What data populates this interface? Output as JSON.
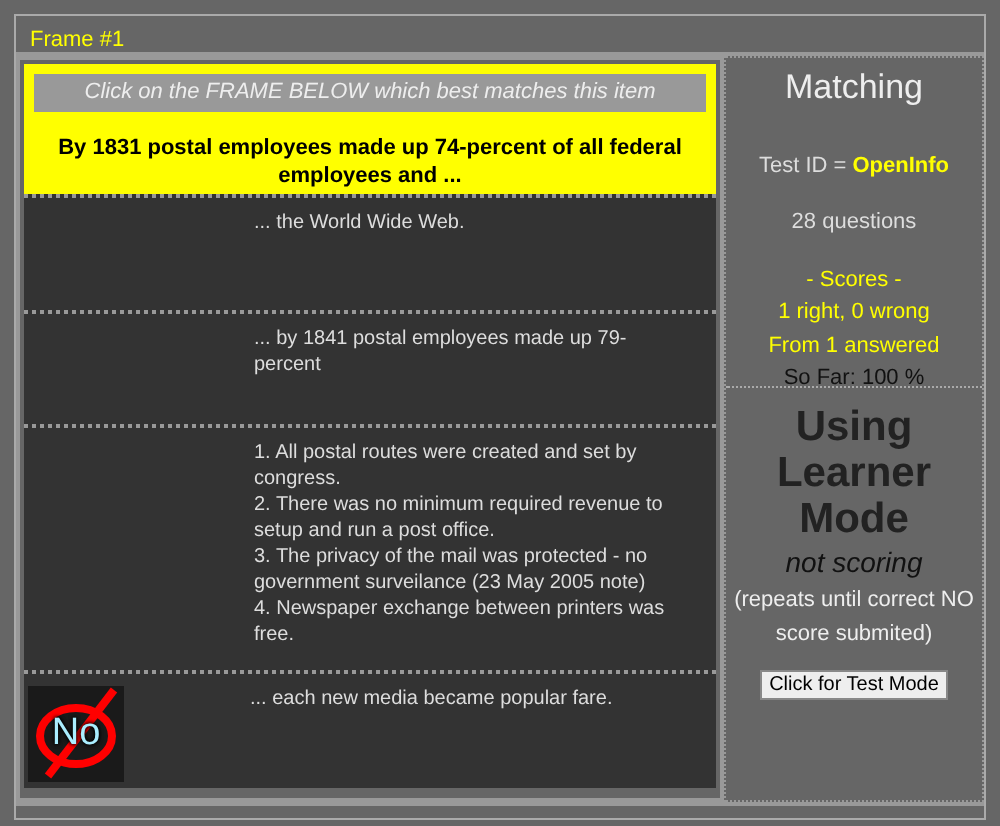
{
  "frame": {
    "title": "Frame #1"
  },
  "question": {
    "instruction": "Click on the FRAME BELOW which best matches this item",
    "prompt": "By 1831 postal employees made up 74-percent of all federal employees and ..."
  },
  "options": [
    {
      "text": "... the World Wide Web.",
      "rejected": false
    },
    {
      "text": "... by 1841 postal employees made up 79-percent",
      "rejected": false
    },
    {
      "text": "1. All postal routes were created and set by congress.\n2. There was no minimum required revenue to setup and run a post office.\n3. The privacy of the mail was protected - no government surveilance (23 May 2005 note)\n4. Newspaper exchange between printers was free.",
      "rejected": false
    },
    {
      "text": "... each new media became popular fare.",
      "rejected": true,
      "rejected_label": "No"
    }
  ],
  "sidebar": {
    "title": "Matching",
    "test_id_label": "Test ID = ",
    "test_id": "OpenInfo",
    "questions": "28 questions",
    "scores": [
      "- Scores -",
      "1 right, 0 wrong",
      "From 1 answered"
    ],
    "so_far": "So Far: 100 %",
    "mode_title": "Using Learner Mode",
    "mode_note": "not scoring",
    "mode_detail": "(repeats until correct NO score submited)",
    "mode_button": "Click for Test Mode"
  }
}
